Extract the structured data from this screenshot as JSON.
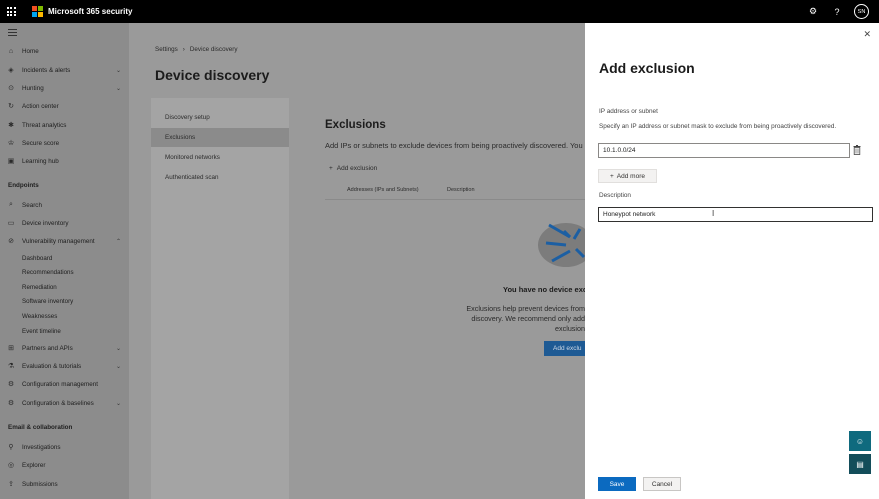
{
  "topbar": {
    "app_title": "Microsoft 365 security",
    "avatar_initials": "SN",
    "logo_colors": [
      "#f25022",
      "#7fba00",
      "#00a4ef",
      "#ffb900"
    ]
  },
  "nav": {
    "items": [
      {
        "label": "Home",
        "icon": "home-icon"
      },
      {
        "label": "Incidents & alerts",
        "icon": "shield-icon"
      },
      {
        "label": "Hunting",
        "icon": "hunting-icon"
      },
      {
        "label": "Action center",
        "icon": "action-center-icon"
      },
      {
        "label": "Threat analytics",
        "icon": "threat-icon"
      },
      {
        "label": "Secure score",
        "icon": "trophy-icon"
      },
      {
        "label": "Learning hub",
        "icon": "learning-icon"
      }
    ],
    "endpoints_section": "Endpoints",
    "endpoint_items": [
      {
        "label": "Search",
        "icon": "search-icon"
      },
      {
        "label": "Device inventory",
        "icon": "device-icon"
      },
      {
        "label": "Vulnerability management",
        "icon": "vuln-icon"
      }
    ],
    "vuln_sub": [
      "Dashboard",
      "Recommendations",
      "Remediation",
      "Software inventory",
      "Weaknesses",
      "Event timeline"
    ],
    "endpoint_items_2": [
      {
        "label": "Partners and APIs",
        "icon": "partners-icon"
      },
      {
        "label": "Evaluation & tutorials",
        "icon": "evaluation-icon"
      },
      {
        "label": "Configuration management",
        "icon": "config-icon"
      },
      {
        "label": "Configuration & baselines",
        "icon": "baselines-icon"
      }
    ],
    "email_section": "Email & collaboration",
    "email_items": [
      {
        "label": "Investigations",
        "icon": "investigations-icon"
      },
      {
        "label": "Explorer",
        "icon": "explorer-icon"
      },
      {
        "label": "Submissions",
        "icon": "submissions-icon"
      }
    ]
  },
  "main": {
    "breadcrumb": [
      "Settings",
      "Device discovery"
    ],
    "title": "Device discovery",
    "settings_tabs": [
      "Discovery setup",
      "Exclusions",
      "Monitored networks",
      "Authenticated scan"
    ],
    "exclusions_title": "Exclusions",
    "exclusions_desc": "Add IPs or subnets to exclude devices from being proactively discovered. You mi",
    "add_exclusion_link": "Add exclusion",
    "columns": [
      "Addresses (IPs and Subnets)",
      "Description"
    ],
    "empty_title": "You have no device exclu",
    "empty_desc_lines": [
      "Exclusions help prevent devices from",
      "discovery. We recommend only add",
      "exclusion"
    ],
    "empty_button": "Add exclu"
  },
  "flyout": {
    "title": "Add exclusion",
    "ip_label": "IP address or subnet",
    "ip_hint": "Specify an IP address or subnet mask to exclude from being proactively discovered.",
    "ip_value": "10.1.0.0/24",
    "add_more": "Add more",
    "description_label": "Description",
    "description_value": "Honeypot network",
    "save": "Save",
    "cancel": "Cancel"
  }
}
